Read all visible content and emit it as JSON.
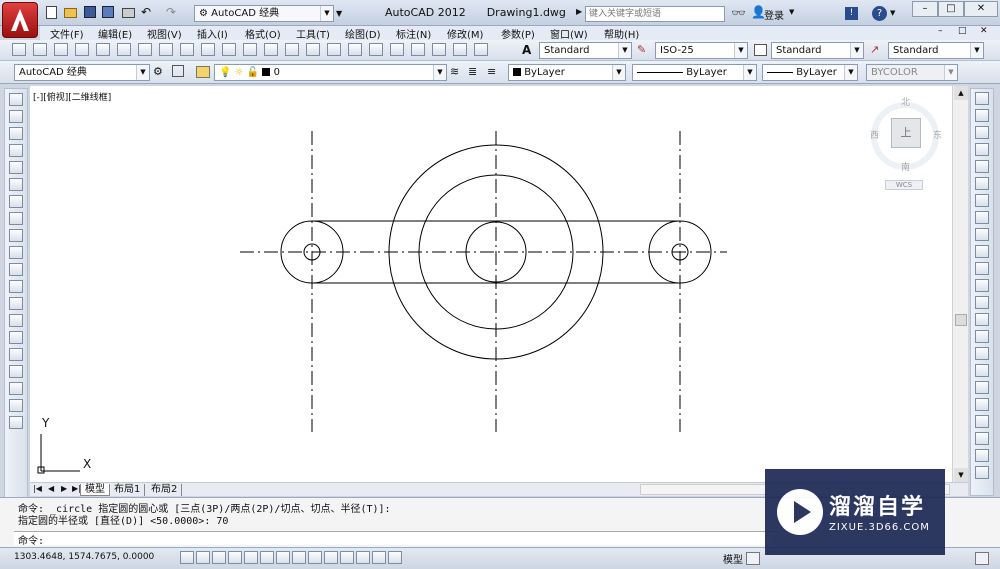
{
  "app": {
    "title": "AutoCAD 2012",
    "document": "Drawing1.dwg",
    "workspace": "AutoCAD 经典",
    "search_placeholder": "键入关键字或短语",
    "login": "登录"
  },
  "menu": [
    "文件(F)",
    "编辑(E)",
    "视图(V)",
    "插入(I)",
    "格式(O)",
    "工具(T)",
    "绘图(D)",
    "标注(N)",
    "修改(M)",
    "参数(P)",
    "窗口(W)",
    "帮助(H)"
  ],
  "styles": {
    "text_style": "Standard",
    "dim_style": "ISO-25",
    "table_style": "Standard",
    "multileader_style": "Standard"
  },
  "layers": {
    "workspace": "AutoCAD 经典",
    "current_layer": "0",
    "color": "ByLayer",
    "linetype": "ByLayer",
    "lineweight": "ByLayer",
    "plotstyle": "BYCOLOR"
  },
  "viewport": {
    "label": "[-][俯视][二维线框]",
    "compass": {
      "north": "北",
      "south": "南",
      "east": "东",
      "west": "西",
      "top": "上"
    },
    "ucs_menu": "WCS",
    "axis_x": "X",
    "axis_y": "Y"
  },
  "layout_tabs": [
    "模型",
    "布局1",
    "布局2"
  ],
  "command_history": [
    "命令: _circle 指定圆的圆心或 [三点(3P)/两点(2P)/切点、切点、半径(T)]:",
    "指定圆的半径或 [直径(D)] <50.0000>: 70"
  ],
  "command_prompt": "命令:",
  "status": {
    "coordinates": "1303.4648, 1574.7675, 0.0000",
    "model_label": "模型"
  },
  "watermark": {
    "brand": "溜溜自学",
    "url": "ZIXUE.3D66.COM"
  },
  "colors": {
    "canvas": "#ffffff",
    "drawing": "#000000",
    "chrome": "#d8e0ec",
    "watermark_bg": "#1f2a55"
  }
}
